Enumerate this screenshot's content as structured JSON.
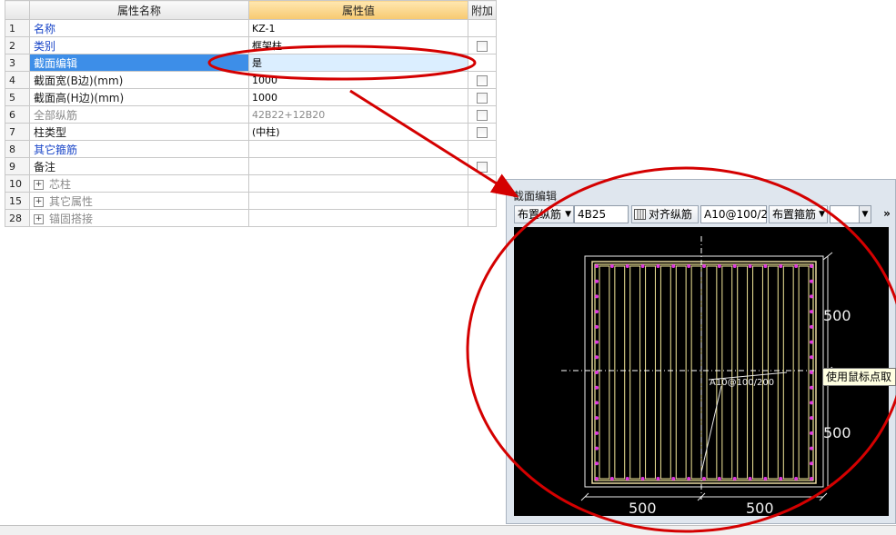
{
  "grid": {
    "headers": {
      "name": "属性名称",
      "value": "属性值",
      "extra": "附加"
    },
    "rows": [
      {
        "num": "1",
        "name": "名称",
        "value": "KZ-1"
      },
      {
        "num": "2",
        "name": "类别",
        "value": "框架柱"
      },
      {
        "num": "3",
        "name": "截面编辑",
        "value": "是"
      },
      {
        "num": "4",
        "name": "截面宽(B边)(mm)",
        "value": "1000"
      },
      {
        "num": "5",
        "name": "截面高(H边)(mm)",
        "value": "1000"
      },
      {
        "num": "6",
        "name": "全部纵筋",
        "value": "42B22+12B20"
      },
      {
        "num": "7",
        "name": "柱类型",
        "value": "(中柱)"
      },
      {
        "num": "8",
        "name": "其它箍筋",
        "value": ""
      },
      {
        "num": "9",
        "name": "备注",
        "value": ""
      },
      {
        "num": "10",
        "name": "芯柱",
        "value": "",
        "expander": "+"
      },
      {
        "num": "15",
        "name": "其它属性",
        "value": "",
        "expander": "+"
      },
      {
        "num": "28",
        "name": "锚固搭接",
        "value": "",
        "expander": "+"
      }
    ]
  },
  "panel": {
    "title": "截面编辑",
    "toolbar": {
      "place_longitudinal": "布置纵筋",
      "longitudinal_spec": "4B25",
      "align_longitudinal": "对齐纵筋",
      "stirrup_spec": "A10@100/2",
      "place_stirrup": "布置箍筋",
      "more": "»"
    },
    "drawing": {
      "dim_right_top": "500",
      "dim_right_bottom": "500",
      "dim_bottom_left": "500",
      "dim_bottom_right": "500",
      "stirrup_label": "A10@100/200"
    }
  },
  "tooltip": "使用鼠标点取",
  "colors": {
    "selected_row": "#3d8ee8",
    "selected_value_cell": "#dbeeff",
    "blue_label": "#1a46c8",
    "annotation_red": "#d40000",
    "column_outline": "#e8d9a0",
    "stirrup_yellow": "#f4e99a",
    "rebar_magenta": "#e03ae0"
  }
}
